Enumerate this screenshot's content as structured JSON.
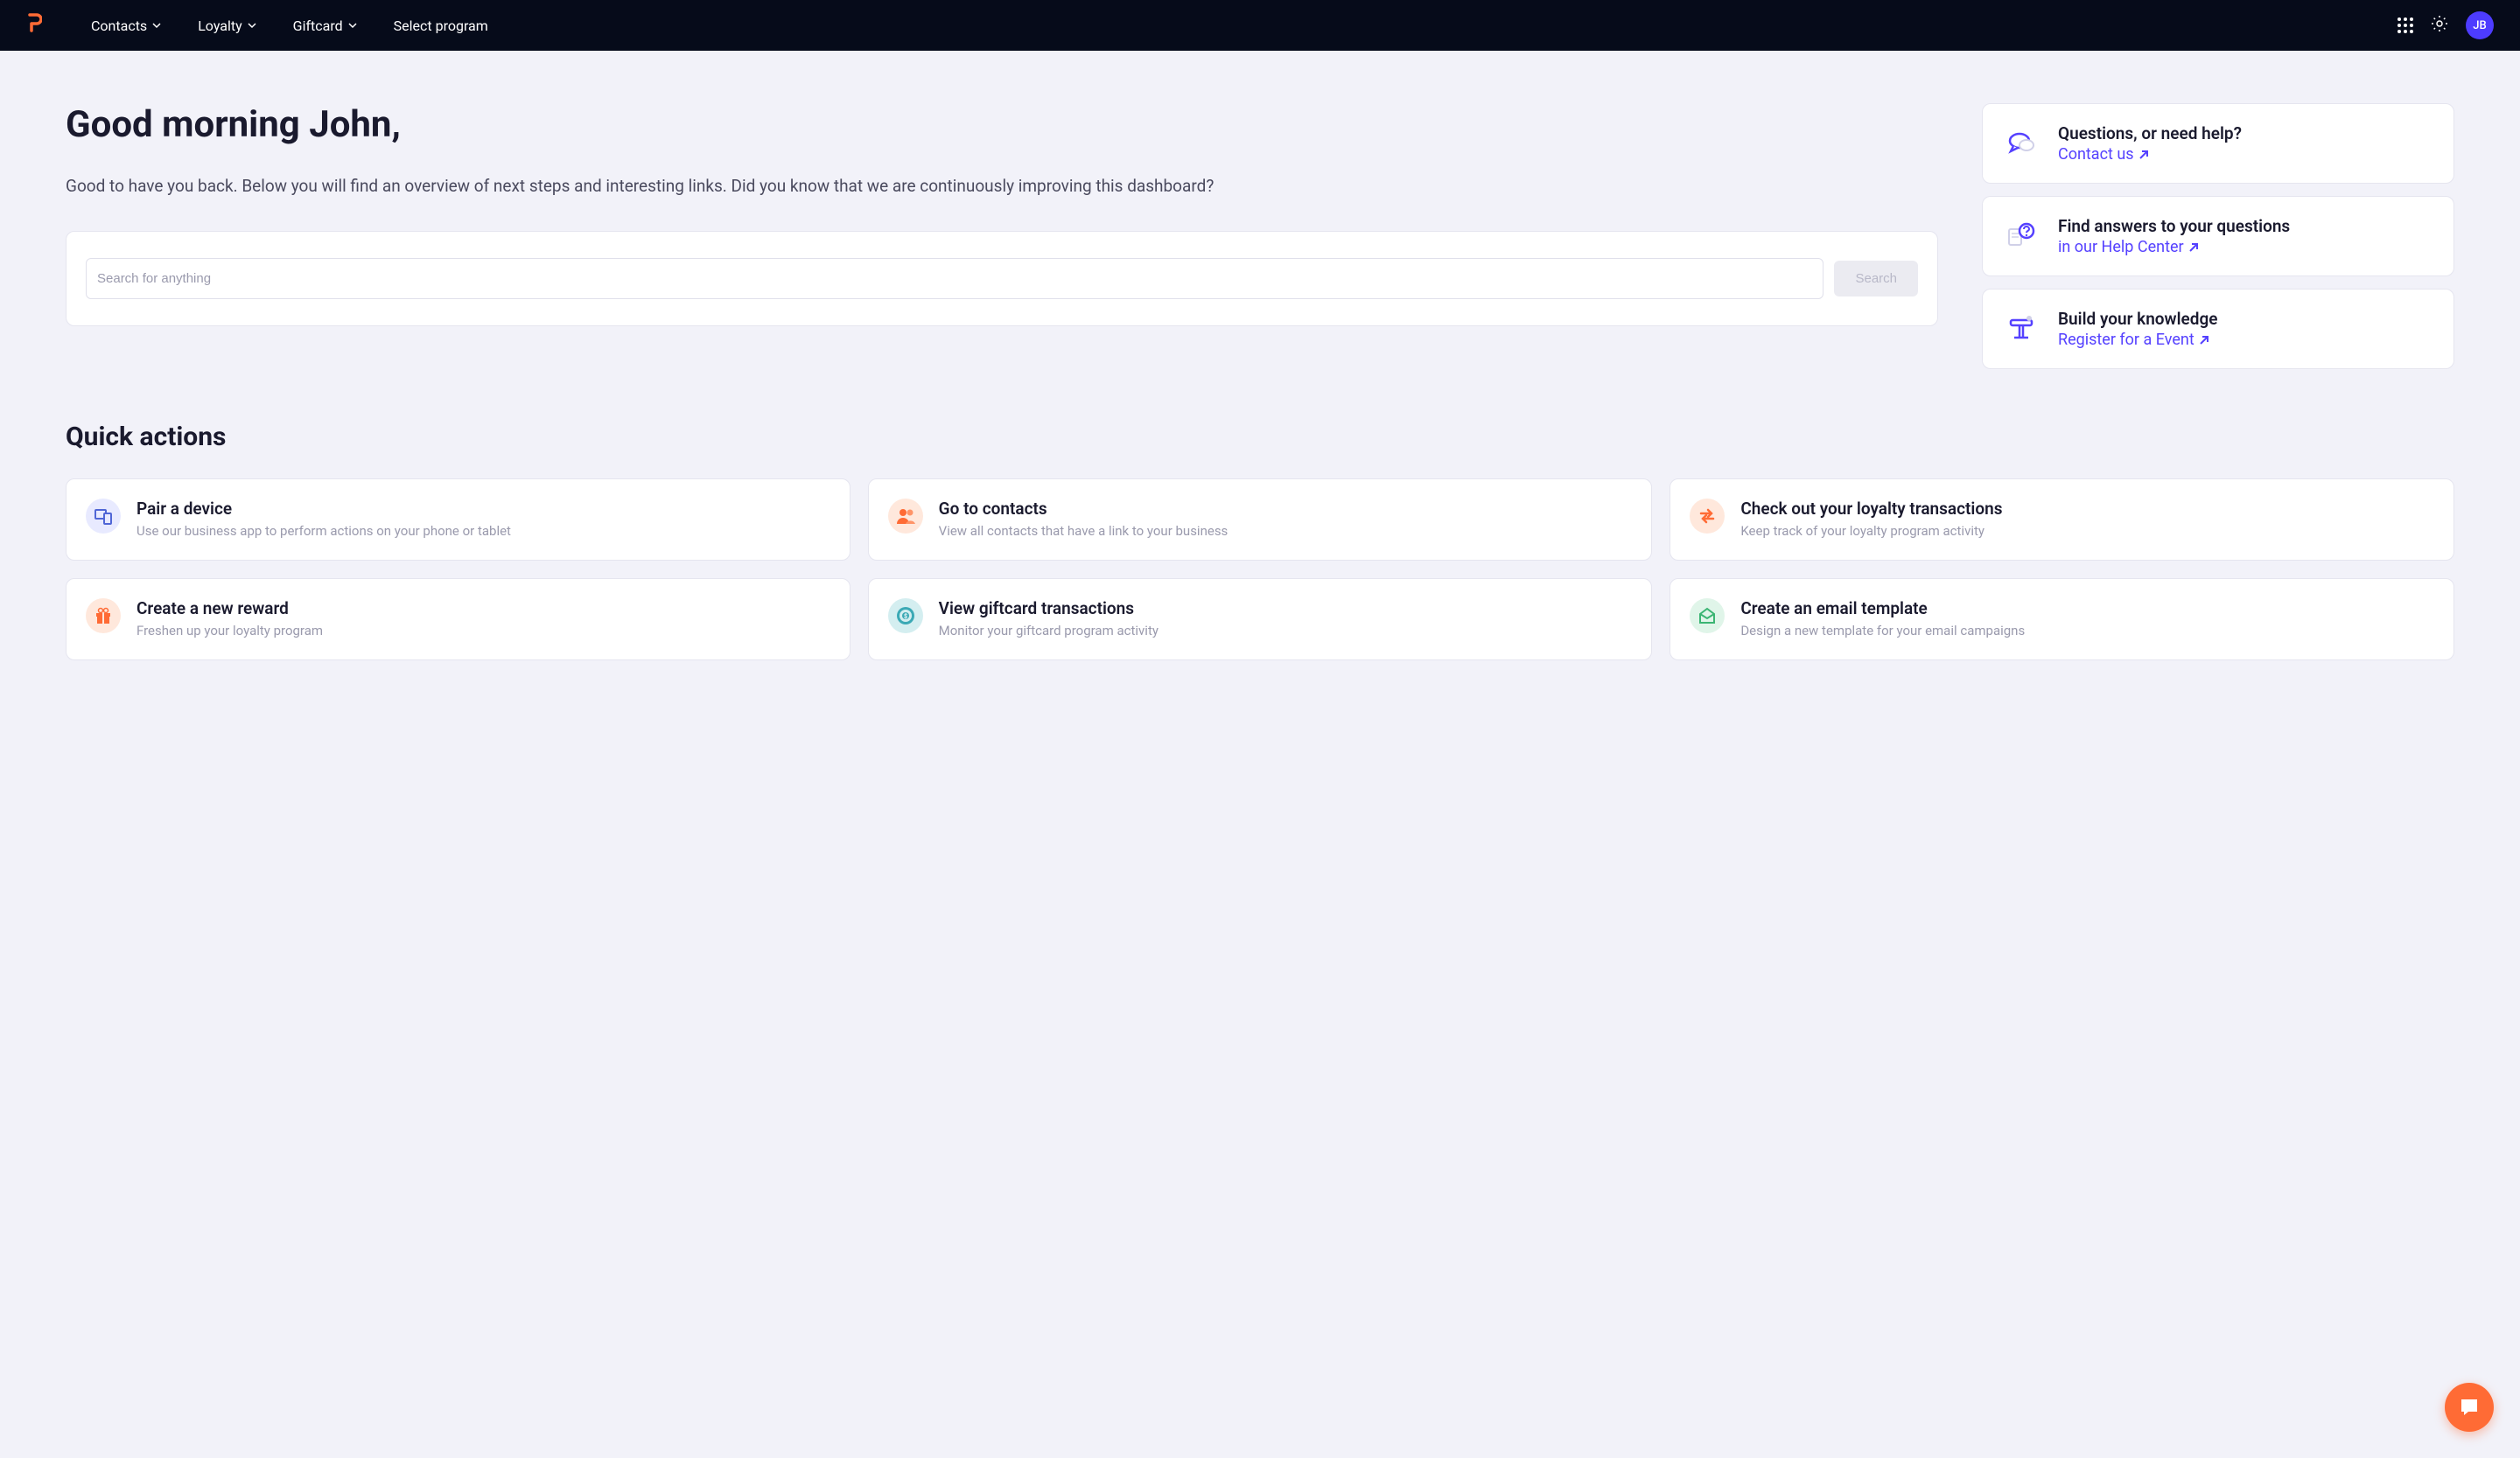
{
  "nav": {
    "items": [
      {
        "label": "Contacts",
        "hasDropdown": true
      },
      {
        "label": "Loyalty",
        "hasDropdown": true
      },
      {
        "label": "Giftcard",
        "hasDropdown": true
      },
      {
        "label": "Select program",
        "hasDropdown": false
      }
    ],
    "avatar_initials": "JB"
  },
  "welcome": {
    "greeting": "Good morning John,",
    "text": "Good to have you back. Below you will find an overview of next steps and interesting links. Did you know that we are continuously improving this dashboard?"
  },
  "search": {
    "placeholder": "Search for anything",
    "button_label": "Search"
  },
  "help_cards": [
    {
      "title": "Questions, or need help?",
      "link_text": "Contact us",
      "icon": "chat-icon"
    },
    {
      "title": "Find answers to your questions",
      "link_text": "in our Help Center",
      "icon": "question-icon"
    },
    {
      "title": "Build your knowledge",
      "link_text": "Register for a Event",
      "icon": "podium-icon"
    }
  ],
  "quick_actions": {
    "heading": "Quick actions",
    "cards": [
      {
        "title": "Pair a device",
        "desc": "Use our business app to perform actions on your phone or tablet",
        "icon": "devices-icon",
        "bg": "bg-blue-light",
        "color": "#5066d6"
      },
      {
        "title": "Go to contacts",
        "desc": "View all contacts that have a link to your business",
        "icon": "people-icon",
        "bg": "bg-orange-light",
        "color": "#ff6b35"
      },
      {
        "title": "Check out your loyalty transactions",
        "desc": "Keep track of your loyalty program activity",
        "icon": "exchange-icon",
        "bg": "bg-orange-light",
        "color": "#ff6b35"
      },
      {
        "title": "Create a new reward",
        "desc": "Freshen up your loyalty program",
        "icon": "gift-icon",
        "bg": "bg-orange-light",
        "color": "#ff6b35"
      },
      {
        "title": "View giftcard transactions",
        "desc": "Monitor your giftcard program activity",
        "icon": "target-icon",
        "bg": "bg-teal-light",
        "color": "#3ba9b5"
      },
      {
        "title": "Create an email template",
        "desc": "Design a new template for your email campaigns",
        "icon": "envelope-open-icon",
        "bg": "bg-green-light",
        "color": "#3bb573"
      }
    ]
  }
}
